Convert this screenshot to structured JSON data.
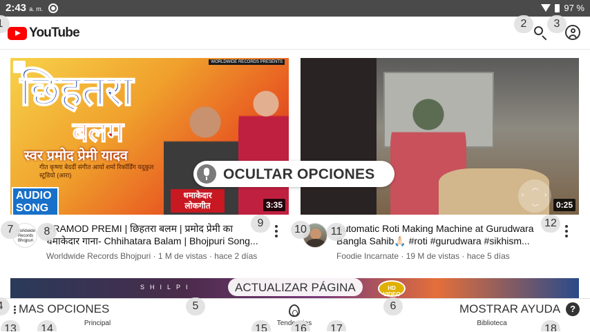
{
  "status_bar": {
    "time": "2:43",
    "ampm": "a. m.",
    "battery": "97 %"
  },
  "header": {
    "logo_text": "YouTube",
    "icons": [
      "search-icon",
      "account-icon"
    ]
  },
  "videos": [
    {
      "thumb": {
        "title_line1": "छिहतरा",
        "title_line2": "बलम",
        "singer": "स्वर प्रमोद प्रेमी यादव",
        "credits": "गीत कृष्णा बेदर्दी  संगीत आर्या शर्मा  रिकॉर्डिंग यदुकुल स्टूडियो (आरा)",
        "audio_badge": "AUDIO SONG",
        "genre_badge": "धमाकेदार लोकगीत",
        "label_tag": "WORLDWIDE RECORDS PRESENTS"
      },
      "duration": "3:35",
      "avatar_text": "Worldwide Records Bhojpuri",
      "title": "PRAMOD PREMI | छिहतरा बलम | प्रमोद प्रेमी का धमाकेदार गाना- Chhihatara Balam | Bhojpuri Song...",
      "meta": "Worldwide Records Bhojpuri · 1 M de vistas · hace 2 días"
    },
    {
      "duration": "0:25",
      "title": "Automatic Roti Making Machine at Gurudwara Bangla Sahib🙏🏻 #roti #gurudwara #sikhism...",
      "meta": "Foodie Incarnate · 19 M de vistas · hace 5 días"
    }
  ],
  "row2": {
    "shilpi": "SHILPI",
    "hd_badge": "HD VIDEO"
  },
  "bottom_nav": {
    "home": "Principal",
    "trending": "Tendencias",
    "library": "Biblioteca"
  },
  "voice_access": {
    "hide_options": "OCULTAR OPCIONES",
    "refresh_page": "ACTUALIZAR PÁGINA",
    "more_options": "MAS OPCIONES",
    "show_help": "MOSTRAR AYUDA",
    "help_symbol": "?",
    "badges": [
      "1",
      "2",
      "3",
      "4",
      "5",
      "6",
      "7",
      "8",
      "9",
      "10",
      "11",
      "12",
      "13",
      "14",
      "15",
      "16",
      "17",
      "18"
    ]
  }
}
